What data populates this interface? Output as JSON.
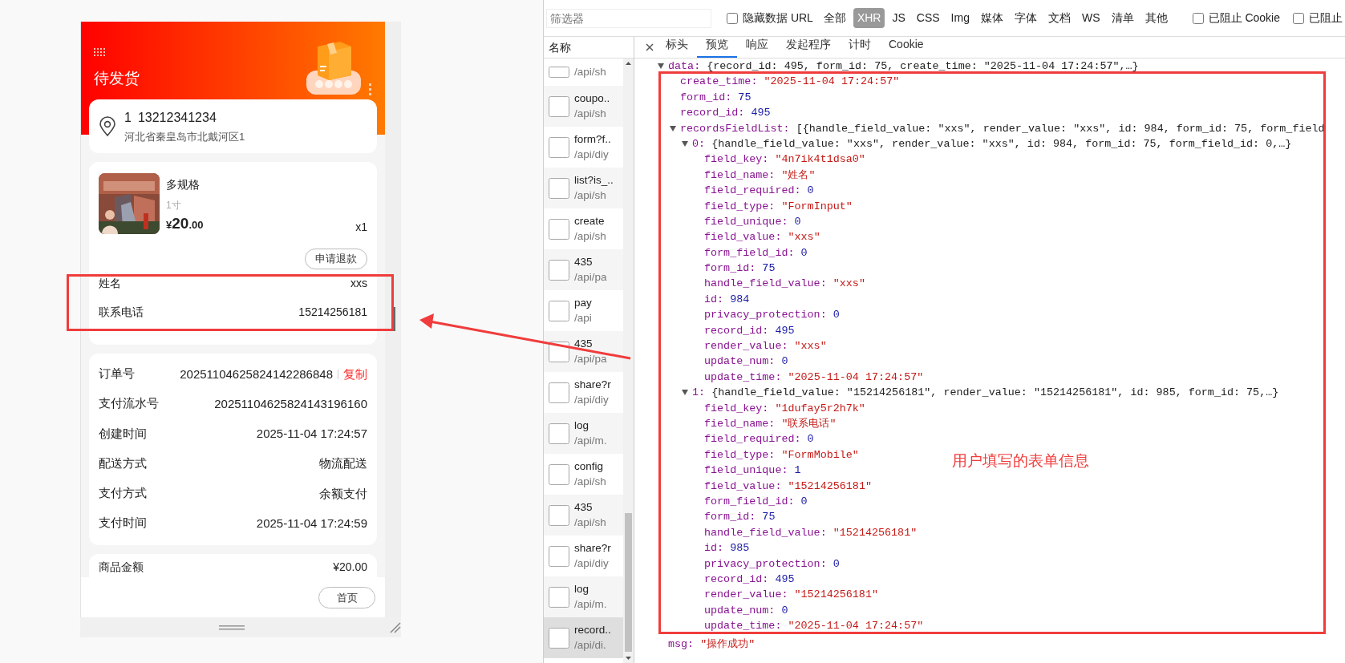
{
  "phone": {
    "header": {
      "title": "待发货"
    },
    "address": {
      "name": "1",
      "phone": "13212341234",
      "detail": "河北省秦皇岛市北戴河区1"
    },
    "product": {
      "title": "多规格",
      "spec": "1寸",
      "currency": "¥",
      "price_integer": "20",
      "price_decimal": ".00",
      "quantity": "x1",
      "refund_button": "申请退款"
    },
    "form_fields": [
      {
        "label": "姓名",
        "value": "xxs"
      },
      {
        "label": "联系电话",
        "value": "15214256181"
      }
    ],
    "order_info": [
      {
        "label": "订单号",
        "value": "20251104625824142286848",
        "action": "复制"
      },
      {
        "label": "支付流水号",
        "value": "20251104625824143196160"
      },
      {
        "label": "创建时间",
        "value": "2025-11-04 17:24:57"
      },
      {
        "label": "配送方式",
        "value": "物流配送"
      },
      {
        "label": "支付方式",
        "value": "余额支付"
      },
      {
        "label": "支付时间",
        "value": "2025-11-04 17:24:59"
      }
    ],
    "amounts": [
      {
        "label": "商品金额",
        "value": "¥20.00"
      }
    ],
    "home_button": "首页"
  },
  "devtools": {
    "filter": {
      "placeholder": "筛选器"
    },
    "hide_data_url": {
      "label": "隐藏数据 URL",
      "checked": false
    },
    "type_filters": [
      {
        "label": "全部",
        "selected": false
      },
      {
        "label": "XHR",
        "selected": true
      },
      {
        "label": "JS",
        "selected": false
      },
      {
        "label": "CSS",
        "selected": false
      },
      {
        "label": "Img",
        "selected": false
      },
      {
        "label": "媒体",
        "selected": false
      },
      {
        "label": "字体",
        "selected": false
      },
      {
        "label": "文档",
        "selected": false
      },
      {
        "label": "WS",
        "selected": false
      },
      {
        "label": "清单",
        "selected": false
      },
      {
        "label": "其他",
        "selected": false
      }
    ],
    "blocked_cookies": {
      "label": "已阻止 Cookie",
      "checked": false
    },
    "blocked_requests": {
      "label": "已阻止",
      "checked": false
    },
    "name_header": "名称",
    "requests": [
      {
        "path": "/api/sh",
        "selected": false
      },
      {
        "name": "coupo..",
        "path": "/api/sh",
        "selected": false
      },
      {
        "name": "form?f..",
        "path": "/api/diy",
        "selected": false
      },
      {
        "name": "list?is_..",
        "path": "/api/sh",
        "selected": false
      },
      {
        "name": "create",
        "path": "/api/sh",
        "selected": false
      },
      {
        "name": "435",
        "path": "/api/pa",
        "selected": false
      },
      {
        "name": "pay",
        "path": "/api",
        "selected": false
      },
      {
        "name": "435",
        "path": "/api/pa",
        "selected": false
      },
      {
        "name": "share?r",
        "path": "/api/diy",
        "selected": false
      },
      {
        "name": "log",
        "path": "/api/m.",
        "selected": false
      },
      {
        "name": "config",
        "path": "/api/sh",
        "selected": false
      },
      {
        "name": "435",
        "path": "/api/sh",
        "selected": false
      },
      {
        "name": "share?r",
        "path": "/api/diy",
        "selected": false
      },
      {
        "name": "log",
        "path": "/api/m.",
        "selected": false
      },
      {
        "name": "record..",
        "path": "/api/di.",
        "selected": true
      }
    ],
    "tabs": [
      {
        "label": "标头",
        "selected": false
      },
      {
        "label": "预览",
        "selected": true
      },
      {
        "label": "响应",
        "selected": false
      },
      {
        "label": "发起程序",
        "selected": false
      },
      {
        "label": "计时",
        "selected": false
      },
      {
        "label": "Cookie",
        "selected": false
      }
    ],
    "preview": [
      {
        "key": "data:",
        "preview": "{record_id: 495, form_id: 75, create_time: \"2025-11-04 17:24:57\",…}",
        "expanded": true,
        "children": [
          {
            "key": "create_time:",
            "value": "\"2025-11-04 17:24:57\"",
            "kind": "string"
          },
          {
            "key": "form_id:",
            "value": "75",
            "kind": "number"
          },
          {
            "key": "record_id:",
            "value": "495",
            "kind": "number"
          },
          {
            "key": "recordsFieldList:",
            "preview": "[{handle_field_value: \"xxs\", render_value: \"xxs\", id: 984, form_id: 75, form_field",
            "expanded": true,
            "children": [
              {
                "key": "0:",
                "preview": "{handle_field_value: \"xxs\", render_value: \"xxs\", id: 984, form_id: 75, form_field_id: 0,…}",
                "expanded": true,
                "children": [
                  {
                    "key": "field_key:",
                    "value": "\"4n7ik4t1dsa0\"",
                    "kind": "string"
                  },
                  {
                    "key": "field_name:",
                    "value": "\"姓名\"",
                    "kind": "string"
                  },
                  {
                    "key": "field_required:",
                    "value": "0",
                    "kind": "number"
                  },
                  {
                    "key": "field_type:",
                    "value": "\"FormInput\"",
                    "kind": "string"
                  },
                  {
                    "key": "field_unique:",
                    "value": "0",
                    "kind": "number"
                  },
                  {
                    "key": "field_value:",
                    "value": "\"xxs\"",
                    "kind": "string"
                  },
                  {
                    "key": "form_field_id:",
                    "value": "0",
                    "kind": "number"
                  },
                  {
                    "key": "form_id:",
                    "value": "75",
                    "kind": "number"
                  },
                  {
                    "key": "handle_field_value:",
                    "value": "\"xxs\"",
                    "kind": "string"
                  },
                  {
                    "key": "id:",
                    "value": "984",
                    "kind": "number"
                  },
                  {
                    "key": "privacy_protection:",
                    "value": "0",
                    "kind": "number"
                  },
                  {
                    "key": "record_id:",
                    "value": "495",
                    "kind": "number"
                  },
                  {
                    "key": "render_value:",
                    "value": "\"xxs\"",
                    "kind": "string"
                  },
                  {
                    "key": "update_num:",
                    "value": "0",
                    "kind": "number"
                  },
                  {
                    "key": "update_time:",
                    "value": "\"2025-11-04 17:24:57\"",
                    "kind": "string"
                  }
                ]
              },
              {
                "key": "1:",
                "preview": "{handle_field_value: \"15214256181\", render_value: \"15214256181\", id: 985, form_id: 75,…}",
                "expanded": true,
                "children": [
                  {
                    "key": "field_key:",
                    "value": "\"1dufay5r2h7k\"",
                    "kind": "string"
                  },
                  {
                    "key": "field_name:",
                    "value": "\"联系电话\"",
                    "kind": "string"
                  },
                  {
                    "key": "field_required:",
                    "value": "0",
                    "kind": "number"
                  },
                  {
                    "key": "field_type:",
                    "value": "\"FormMobile\"",
                    "kind": "string"
                  },
                  {
                    "key": "field_unique:",
                    "value": "1",
                    "kind": "number"
                  },
                  {
                    "key": "field_value:",
                    "value": "\"15214256181\"",
                    "kind": "string"
                  },
                  {
                    "key": "form_field_id:",
                    "value": "0",
                    "kind": "number"
                  },
                  {
                    "key": "form_id:",
                    "value": "75",
                    "kind": "number"
                  },
                  {
                    "key": "handle_field_value:",
                    "value": "\"15214256181\"",
                    "kind": "string"
                  },
                  {
                    "key": "id:",
                    "value": "985",
                    "kind": "number"
                  },
                  {
                    "key": "privacy_protection:",
                    "value": "0",
                    "kind": "number"
                  },
                  {
                    "key": "record_id:",
                    "value": "495",
                    "kind": "number"
                  },
                  {
                    "key": "render_value:",
                    "value": "\"15214256181\"",
                    "kind": "string"
                  },
                  {
                    "key": "update_num:",
                    "value": "0",
                    "kind": "number"
                  },
                  {
                    "key": "update_time:",
                    "value": "\"2025-11-04 17:24:57\"",
                    "kind": "string"
                  }
                ]
              }
            ]
          }
        ]
      },
      {
        "key": "msg:",
        "value": "\"操作成功\"",
        "kind": "string"
      }
    ]
  },
  "annotations": {
    "note": "用户填写的表单信息"
  }
}
